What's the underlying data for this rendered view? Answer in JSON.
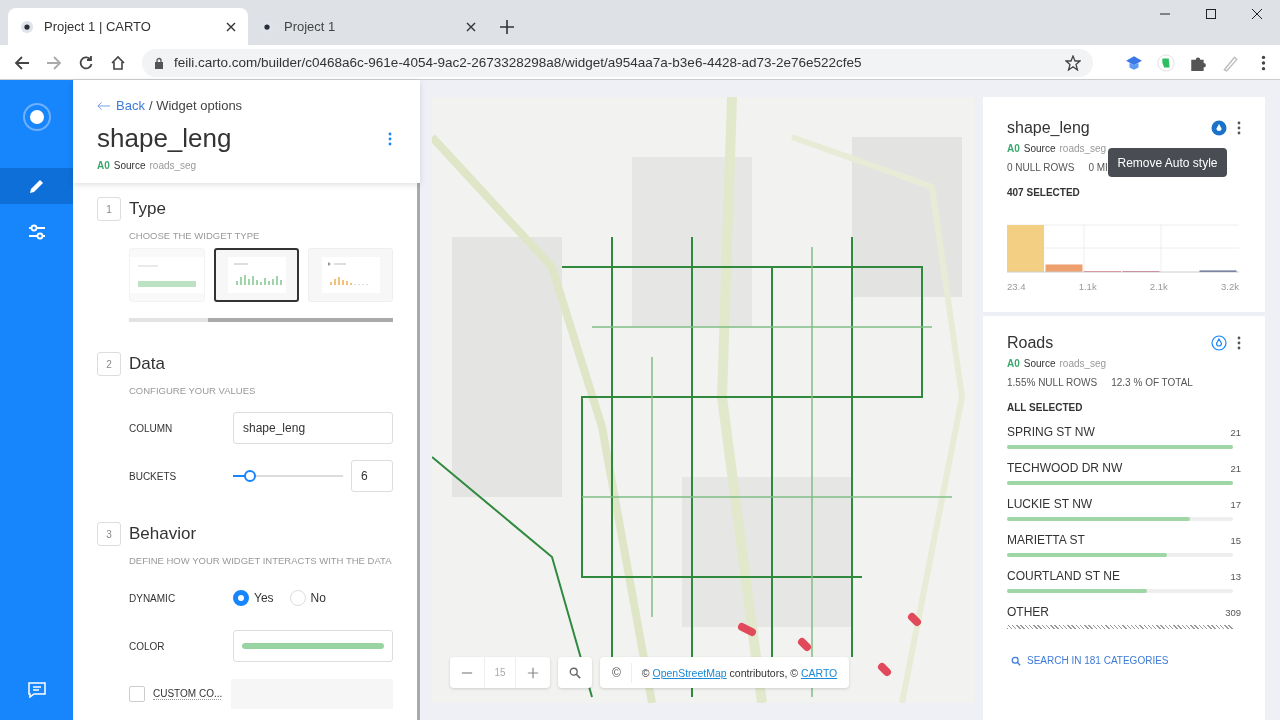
{
  "browser": {
    "tabs": [
      {
        "title": "Project 1 | CARTO",
        "selected": true
      },
      {
        "title": "Project 1",
        "selected": false
      }
    ],
    "url": "feili.carto.com/builder/c0468a6c-961e-4054-9ac2-2673328298a8/widget/a954aa7a-b3e6-4428-ad73-2e76e522cfe5"
  },
  "sidebar": {
    "items": [
      {
        "kind": "edit",
        "selected": true
      },
      {
        "kind": "filters",
        "selected": false
      }
    ]
  },
  "panel": {
    "back": "Back",
    "crumb": "/ Widget options",
    "title": "shape_leng",
    "source": {
      "tag": "A0",
      "label": "Source",
      "name": "roads_seg"
    },
    "sections": [
      {
        "number": "1",
        "title": "Type",
        "subtitle": "CHOOSE THE WIDGET TYPE",
        "kind": "types",
        "options": [
          {
            "kind": "formula",
            "selected": false
          },
          {
            "kind": "histogram",
            "selected": true
          },
          {
            "kind": "timeseries",
            "selected": false
          }
        ]
      },
      {
        "number": "2",
        "title": "Data",
        "subtitle": "CONFIGURE YOUR VALUES",
        "kind": "fields",
        "fields": [
          {
            "kind": "text",
            "label": "COLUMN",
            "value": "shape_leng"
          },
          {
            "kind": "slider",
            "label": "BUCKETS",
            "level": 0.15,
            "value": "6"
          }
        ]
      },
      {
        "number": "3",
        "title": "Behavior",
        "subtitle": "DEFINE HOW YOUR WIDGET INTERACTS WITH THE DATA",
        "kind": "fields",
        "fields": [
          {
            "kind": "radio",
            "label": "DYNAMIC",
            "options": [
              {
                "label": "Yes",
                "selected": true
              },
              {
                "label": "No",
                "selected": false
              }
            ]
          },
          {
            "kind": "color",
            "label": "COLOR"
          },
          {
            "kind": "checkbox",
            "label": "CUSTOM CO...",
            "checked": false
          }
        ]
      }
    ]
  },
  "map": {
    "zoom": "15",
    "info": "©",
    "attribution": [
      {
        "text": "© "
      },
      {
        "text": "OpenStreetMap",
        "link": true
      },
      {
        "text": " contributors, © "
      },
      {
        "text": "CARTO",
        "link": true
      }
    ]
  },
  "widgets": [
    {
      "kind": "histogram",
      "title": "shape_leng",
      "autostyle_active": true,
      "tooltip": "Remove Auto style",
      "source": {
        "tag": "A0",
        "label": "Source",
        "name": "roads_seg"
      },
      "stats": [
        "0 NULL ROWS",
        "0 MI"
      ],
      "selection": "407 SELECTED",
      "axis": [
        "23.4",
        "1.1k",
        "2.1k",
        "3.2k"
      ]
    },
    {
      "kind": "category",
      "title": "Roads",
      "autostyle_active": false,
      "source": {
        "tag": "A0",
        "label": "Source",
        "name": "roads_seg"
      },
      "stats": [
        "1.55% NULL ROWS",
        "12.3 % OF TOTAL"
      ],
      "selection": "ALL SELECTED",
      "categories": [
        {
          "kind": "bar",
          "name": "SPRING ST NW",
          "count": "21",
          "level": 1
        },
        {
          "kind": "bar",
          "name": "TECHWOOD DR NW",
          "count": "21",
          "level": 1
        },
        {
          "kind": "bar",
          "name": "LUCKIE ST NW",
          "count": "17",
          "level": 0.81
        },
        {
          "kind": "bar",
          "name": "MARIETTA ST",
          "count": "15",
          "level": 0.71
        },
        {
          "kind": "bar",
          "name": "COURTLAND ST NE",
          "count": "13",
          "level": 0.62
        },
        {
          "kind": "other",
          "name": "OTHER",
          "count": "309"
        }
      ],
      "search": "SEARCH IN 181 CATEGORIES"
    }
  ]
}
